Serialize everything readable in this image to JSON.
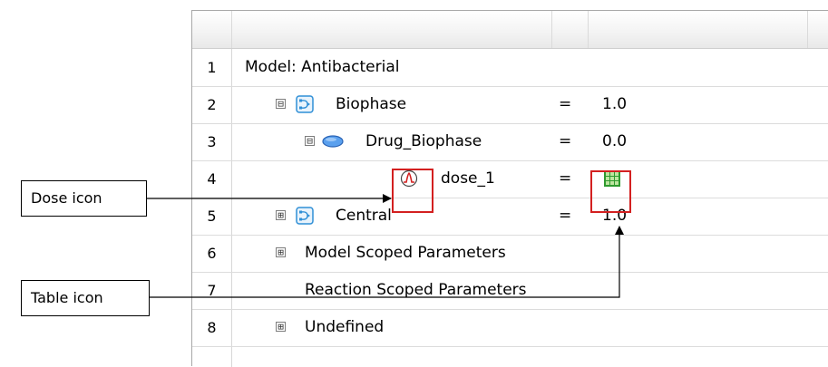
{
  "rows": [
    {
      "num": "1",
      "label": "Model: Antibacterial",
      "eq": "",
      "value": ""
    },
    {
      "num": "2",
      "label": "Biophase",
      "eq": "=",
      "value": "1.0",
      "expander": "⊟"
    },
    {
      "num": "3",
      "label": "Drug_Biophase",
      "eq": "=",
      "value": "0.0",
      "expander": "⊟"
    },
    {
      "num": "4",
      "label": "dose_1",
      "eq": "=",
      "value": ""
    },
    {
      "num": "5",
      "label": "Central",
      "eq": "=",
      "value": "1.0",
      "expander": "⊞"
    },
    {
      "num": "6",
      "label": "Model Scoped Parameters",
      "eq": "",
      "value": "",
      "expander": "⊞"
    },
    {
      "num": "7",
      "label": "Reaction Scoped Parameters",
      "eq": "",
      "value": ""
    },
    {
      "num": "8",
      "label": "Undefined",
      "eq": "",
      "value": "",
      "expander": "⊞"
    }
  ],
  "callouts": {
    "dose": "Dose icon",
    "table": "Table icon"
  },
  "icons": {
    "compartment": "compartment-icon",
    "species": "species-icon",
    "dose": "dose-icon",
    "table": "table-icon"
  },
  "colors": {
    "highlight": "#d32020",
    "compartment_blue": "#2f8fd6",
    "species_blue": "#3a7fd4",
    "table_green": "#2e9a2e"
  }
}
